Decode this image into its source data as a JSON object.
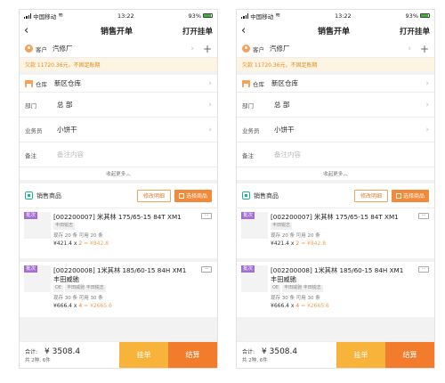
{
  "status": {
    "carrier": "中国移动",
    "time": "13:22",
    "battery": "93%",
    "battery_level": 0.93
  },
  "nav": {
    "back_icon": "chevron-left-icon",
    "title": "销售开单",
    "right_action": "打开挂单"
  },
  "customer": {
    "label": "客户",
    "value": "汽修厂"
  },
  "debt_notice": "欠款 11720.36元，不固定账期",
  "warehouse": {
    "label": "仓库",
    "value": "新区仓库"
  },
  "fields": {
    "dept": {
      "label": "部门",
      "value": "总 部"
    },
    "salesman": {
      "label": "业务员",
      "value": "小饼干"
    },
    "note": {
      "label": "备注",
      "placeholder": "备注内容"
    }
  },
  "collapse": "收起更多",
  "goods": {
    "title": "销售商品",
    "edit_label": "修改明细",
    "select_label": "选择商品"
  },
  "items": [
    {
      "badge": "批次",
      "name": "[002200007] 米其林 175/65-15 84T XM1",
      "tags": [
        "丰田锐志"
      ],
      "stock": "现存 20 条  可用 20 条",
      "price": "¥421.4 x ",
      "qty": "2",
      "total": " = ¥842.8"
    },
    {
      "badge": "批次",
      "name": "[002200008] 1米其林 185/60-15 84H XM1",
      "subname": "丰田威驰",
      "tags": [
        "OE",
        "丰田威驰 丰田锐志"
      ],
      "stock": "现存 30 条  可用 30 条",
      "price": "¥666.4 x ",
      "qty": "4",
      "total": " = ¥2665.6"
    }
  ],
  "footer": {
    "sum_label": "合计:",
    "amount": "¥ 3508.4",
    "sub": "共 2种, 6件",
    "hold": "挂单",
    "pay": "结算"
  }
}
